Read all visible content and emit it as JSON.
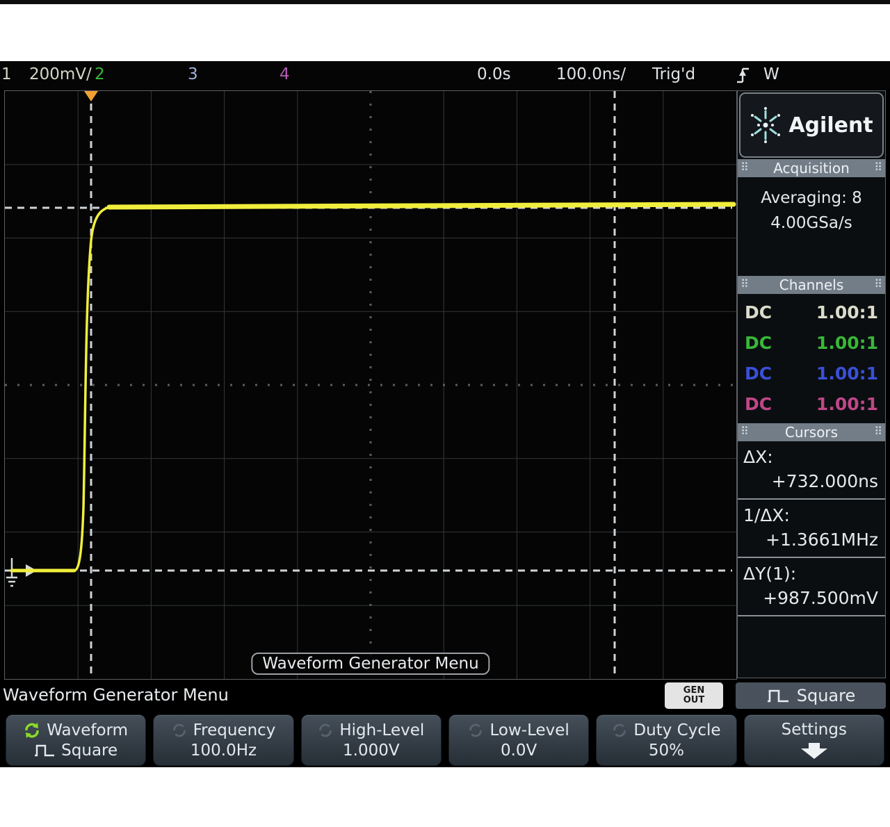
{
  "status_bar": {
    "ch1_number": "1",
    "ch1_scale": "200mV/",
    "ch2_number": "2",
    "ch3_number": "3",
    "ch4_number": "4",
    "delay_time": "0.0s",
    "timebase": "100.0ns/",
    "trigger_status": "Trig'd",
    "trigger_source": "W"
  },
  "brand": {
    "name": "Agilent"
  },
  "sidebar": {
    "acquisition": {
      "title": "Acquisition",
      "mode": "Averaging: 8",
      "sample_rate": "4.00GSa/s"
    },
    "channels": {
      "title": "Channels",
      "rows": [
        {
          "coupling": "DC",
          "probe_ratio": "1.00:1"
        },
        {
          "coupling": "DC",
          "probe_ratio": "1.00:1"
        },
        {
          "coupling": "DC",
          "probe_ratio": "1.00:1"
        },
        {
          "coupling": "DC",
          "probe_ratio": "1.00:1"
        }
      ]
    },
    "cursors": {
      "title": "Cursors",
      "items": [
        {
          "label": "ΔX:",
          "value": "+732.000ns"
        },
        {
          "label": "1/ΔX:",
          "value": "+1.3661MHz"
        },
        {
          "label": "ΔY(1):",
          "value": "+987.500mV"
        }
      ]
    }
  },
  "plot": {
    "overlay_label": "Waveform Generator Menu"
  },
  "menu_bar": {
    "title": "Waveform Generator Menu",
    "gen_out_button": {
      "line1": "GEN",
      "line2": "OUT"
    },
    "gen_status": "Square"
  },
  "softkeys": [
    {
      "label": "Waveform",
      "value": "Square"
    },
    {
      "label": "Frequency",
      "value": "100.0Hz"
    },
    {
      "label": "High-Level",
      "value": "1.000V"
    },
    {
      "label": "Low-Level",
      "value": "0.0V"
    },
    {
      "label": "Duty Cycle",
      "value": "50%"
    },
    {
      "label": "Settings",
      "value": ""
    }
  ],
  "waveform": {
    "channel": "1",
    "shape": "square wave rising edge",
    "low_level": "0.0V",
    "high_level": "1.000V",
    "volts_per_division": "200mV",
    "time_per_division": "100.0ns",
    "color": "#f0ee3c"
  },
  "colors": {
    "ch1": "#dcdcca",
    "ch2": "#38b838",
    "ch3": "#3a50d8",
    "ch4": "#bf4787",
    "trigger_marker": "#f0a030",
    "cursor_lines": "#cfd3d6",
    "header_bg": "#737d88",
    "softkey_bg": "#333d46",
    "accent_green": "#8bdc28"
  }
}
